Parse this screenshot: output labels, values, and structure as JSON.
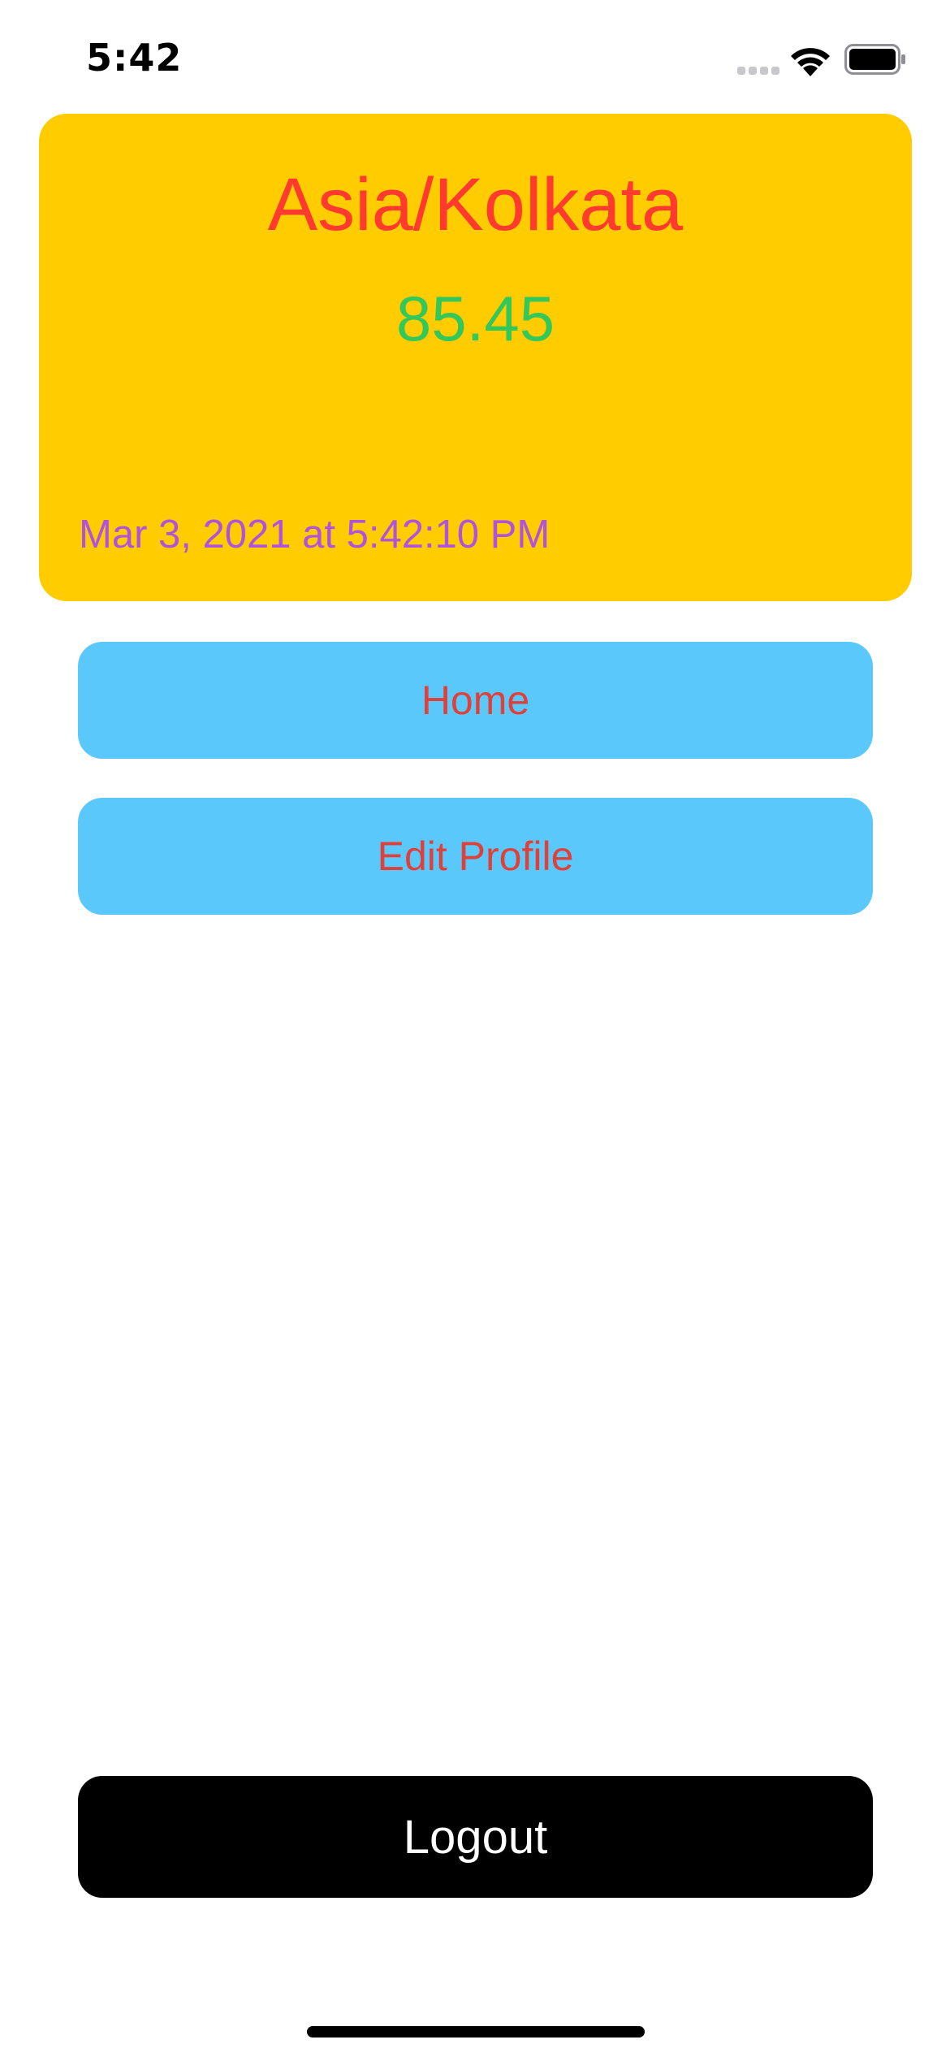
{
  "status_bar": {
    "time": "5:42",
    "signal_icon": "cellular-signal-icon",
    "wifi_icon": "wifi-icon",
    "battery_icon": "battery-icon"
  },
  "card": {
    "timezone": "Asia/Kolkata",
    "value": "85.45",
    "datetime": "Mar 3, 2021 at 5:42:10 PM"
  },
  "buttons": {
    "home": "Home",
    "edit_profile": "Edit Profile",
    "logout": "Logout"
  },
  "colors": {
    "card_background": "#ffcc00",
    "timezone_text": "#ff3b30",
    "value_text": "#34c759",
    "datetime_text": "#af52de",
    "button_background": "#5ac8fa",
    "button_text": "#e0403a",
    "logout_background": "#000000",
    "logout_text": "#ffffff"
  }
}
